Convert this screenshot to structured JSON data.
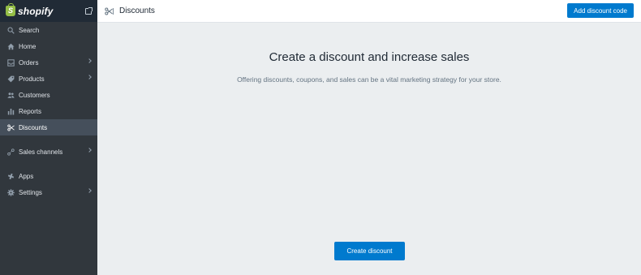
{
  "brand": {
    "name": "shopify"
  },
  "nav": [
    {
      "label": "Search",
      "icon": "search-icon",
      "chevron": false
    },
    {
      "label": "Home",
      "icon": "home-icon",
      "chevron": false
    },
    {
      "label": "Orders",
      "icon": "orders-icon",
      "chevron": true
    },
    {
      "label": "Products",
      "icon": "tag-icon",
      "chevron": true
    },
    {
      "label": "Customers",
      "icon": "customers-icon",
      "chevron": false
    },
    {
      "label": "Reports",
      "icon": "bar-chart-icon",
      "chevron": false
    },
    {
      "label": "Discounts",
      "icon": "discount-icon",
      "chevron": false,
      "active": true
    },
    {
      "label": "Sales channels",
      "icon": "sales-channels-icon",
      "chevron": true
    },
    {
      "label": "Apps",
      "icon": "apps-icon",
      "chevron": false
    },
    {
      "label": "Settings",
      "icon": "gear-icon",
      "chevron": true
    }
  ],
  "header": {
    "title": "Discounts",
    "add_button": "Add discount code"
  },
  "main": {
    "headline": "Create a discount and increase sales",
    "subtext": "Offering discounts, coupons, and sales can be a vital marketing strategy for your store.",
    "create_button": "Create discount"
  },
  "colors": {
    "accent": "#007ace",
    "sidebar": "#31373d",
    "brand_bar": "#212b36",
    "background": "#ebeef0"
  }
}
